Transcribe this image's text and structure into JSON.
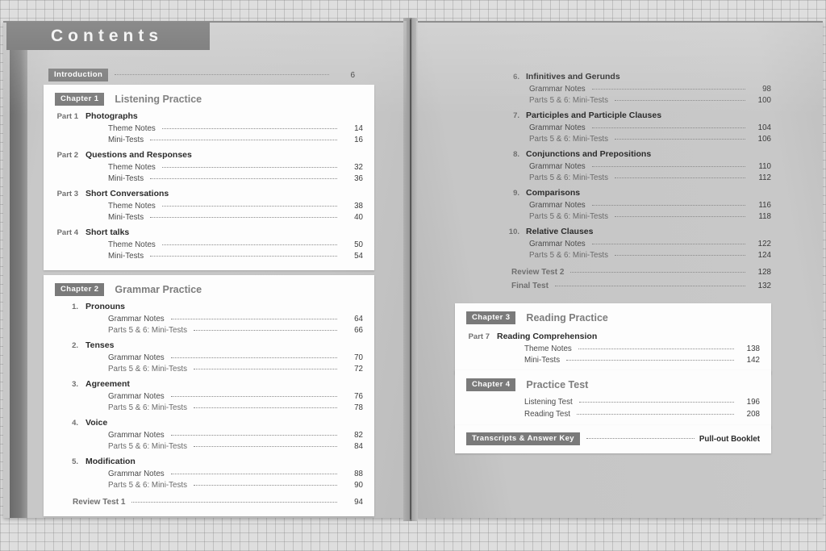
{
  "banner": {
    "title": "Contents"
  },
  "left_page": {
    "intro": {
      "label": "Introduction",
      "page": "6"
    },
    "chapter1": {
      "badge": "Chapter 1",
      "title": "Listening Practice",
      "parts": [
        {
          "num": "Part 1",
          "name": "Photographs",
          "rows": [
            {
              "label": "Theme Notes",
              "page": "14"
            },
            {
              "label": "Mini-Tests",
              "page": "16"
            }
          ]
        },
        {
          "num": "Part 2",
          "name": "Questions and Responses",
          "rows": [
            {
              "label": "Theme Notes",
              "page": "32"
            },
            {
              "label": "Mini-Tests",
              "page": "36"
            }
          ]
        },
        {
          "num": "Part 3",
          "name": "Short Conversations",
          "rows": [
            {
              "label": "Theme Notes",
              "page": "38"
            },
            {
              "label": "Mini-Tests",
              "page": "40"
            }
          ]
        },
        {
          "num": "Part 4",
          "name": "Short talks",
          "rows": [
            {
              "label": "Theme Notes",
              "page": "50"
            },
            {
              "label": "Mini-Tests",
              "page": "54"
            }
          ]
        }
      ]
    },
    "chapter2": {
      "badge": "Chapter 2",
      "title": "Grammar Practice",
      "units": [
        {
          "num": "1.",
          "name": "Pronouns",
          "rows": [
            {
              "label": "Grammar Notes",
              "page": "64"
            },
            {
              "label": "Parts 5 & 6: Mini-Tests",
              "page": "66"
            }
          ]
        },
        {
          "num": "2.",
          "name": "Tenses",
          "rows": [
            {
              "label": "Grammar Notes",
              "page": "70"
            },
            {
              "label": "Parts 5 & 6: Mini-Tests",
              "page": "72"
            }
          ]
        },
        {
          "num": "3.",
          "name": "Agreement",
          "rows": [
            {
              "label": "Grammar Notes",
              "page": "76"
            },
            {
              "label": "Parts 5 & 6: Mini-Tests",
              "page": "78"
            }
          ]
        },
        {
          "num": "4.",
          "name": "Voice",
          "rows": [
            {
              "label": "Grammar Notes",
              "page": "82"
            },
            {
              "label": "Parts 5 & 6: Mini-Tests",
              "page": "84"
            }
          ]
        },
        {
          "num": "5.",
          "name": "Modification",
          "rows": [
            {
              "label": "Grammar Notes",
              "page": "88"
            },
            {
              "label": "Parts 5 & 6: Mini-Tests",
              "page": "90"
            }
          ]
        }
      ],
      "review": {
        "label": "Review Test 1",
        "page": "94"
      }
    }
  },
  "right_page": {
    "grammar_continued": {
      "units": [
        {
          "num": "6.",
          "name": "Infinitives and Gerunds",
          "rows": [
            {
              "label": "Grammar Notes",
              "page": "98"
            },
            {
              "label": "Parts 5 & 6: Mini-Tests",
              "page": "100"
            }
          ]
        },
        {
          "num": "7.",
          "name": "Participles and Participle Clauses",
          "rows": [
            {
              "label": "Grammar Notes",
              "page": "104"
            },
            {
              "label": "Parts 5 & 6: Mini-Tests",
              "page": "106"
            }
          ]
        },
        {
          "num": "8.",
          "name": "Conjunctions and Prepositions",
          "rows": [
            {
              "label": "Grammar Notes",
              "page": "110"
            },
            {
              "label": "Parts 5 & 6: Mini-Tests",
              "page": "112"
            }
          ]
        },
        {
          "num": "9.",
          "name": "Comparisons",
          "rows": [
            {
              "label": "Grammar Notes",
              "page": "116"
            },
            {
              "label": "Parts 5 & 6: Mini-Tests",
              "page": "118"
            }
          ]
        },
        {
          "num": "10.",
          "name": "Relative Clauses",
          "rows": [
            {
              "label": "Grammar Notes",
              "page": "122"
            },
            {
              "label": "Parts 5 & 6: Mini-Tests",
              "page": "124"
            }
          ]
        }
      ],
      "review": {
        "label": "Review Test 2",
        "page": "128"
      },
      "final": {
        "label": "Final Test",
        "page": "132"
      }
    },
    "chapter3": {
      "badge": "Chapter 3",
      "title": "Reading Practice",
      "parts": [
        {
          "num": "Part 7",
          "name": "Reading Comprehension",
          "rows": [
            {
              "label": "Theme Notes",
              "page": "138"
            },
            {
              "label": "Mini-Tests",
              "page": "142"
            }
          ]
        }
      ]
    },
    "chapter4": {
      "badge": "Chapter 4",
      "title": "Practice Test",
      "rows": [
        {
          "label": "Listening Test",
          "page": "196"
        },
        {
          "label": "Reading Test",
          "page": "208"
        }
      ]
    },
    "transcripts": {
      "badge": "Transcripts & Answer Key",
      "page_text": "Pull-out Booklet"
    }
  },
  "colors": {
    "badge_gray": "#7a7a7a",
    "banner_gray": "#6b6b6b",
    "page_gray": "#c6c6c6",
    "card_white": "#fdfdfd"
  }
}
